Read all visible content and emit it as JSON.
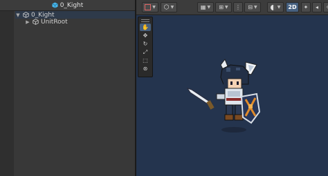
{
  "hierarchy": {
    "title": "0_Kight",
    "root": {
      "label": "0_Kight",
      "expanded": true
    },
    "children": [
      {
        "label": "UnitRoot",
        "expanded": false
      }
    ]
  },
  "scene": {
    "toolbar": {
      "mode_2d_label": "2D"
    },
    "tools": [
      "hand-tool",
      "move-tool",
      "rotate-tool",
      "scale-tool",
      "rect-tool",
      "transform-tool"
    ],
    "active_tool": "hand-tool",
    "background": "#24344e"
  },
  "colors": {
    "selection": "#2e3a4a",
    "active": "#46607f",
    "prefab_blue": "#48b4e8"
  }
}
